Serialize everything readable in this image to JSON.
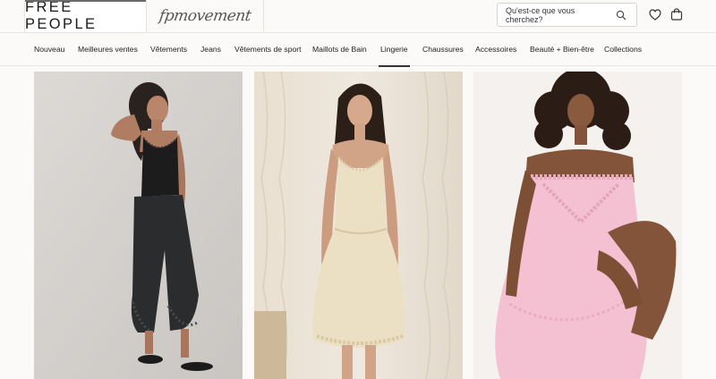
{
  "header": {
    "brand_primary": "FREE PEOPLE",
    "brand_secondary": "fpmovement",
    "search": {
      "placeholder": "Qu'est-ce que vous cherchez?"
    },
    "icons": [
      "search-icon",
      "heart-icon",
      "bag-icon"
    ]
  },
  "nav": {
    "items": [
      {
        "label": "Nouveau",
        "active": false
      },
      {
        "label": "Meilleures ventes",
        "active": false
      },
      {
        "label": "Vêtements",
        "active": false
      },
      {
        "label": "Jeans",
        "active": false
      },
      {
        "label": "Vêtements de sport",
        "active": false
      },
      {
        "label": "Maillots de Bain",
        "active": false
      },
      {
        "label": "Lingerie",
        "active": true
      },
      {
        "label": "Chaussures",
        "active": false
      },
      {
        "label": "Accessoires",
        "active": false
      },
      {
        "label": "Beauté + Bien-être",
        "active": false
      },
      {
        "label": "Collections",
        "active": false
      }
    ]
  },
  "products": [
    {
      "image": "model-black-lace-cami-and-bloomers"
    },
    {
      "image": "model-cream-lace-slip-dress"
    },
    {
      "image": "model-pink-lace-slip-dress"
    }
  ],
  "colors": {
    "background": "#fbfaf8",
    "text": "#222222",
    "border": "#e6e3df"
  }
}
